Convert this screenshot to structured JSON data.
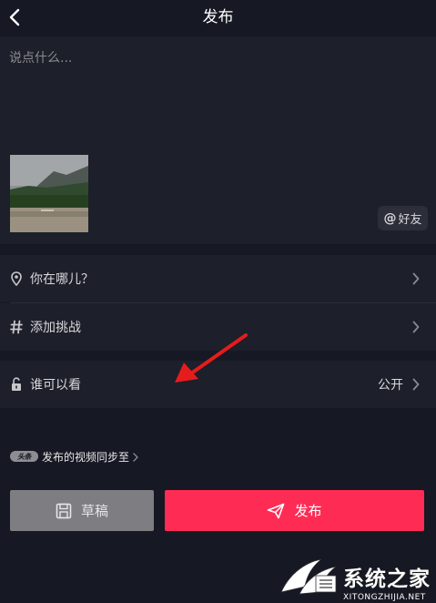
{
  "header": {
    "title": "发布"
  },
  "compose": {
    "placeholder": "说点什么...",
    "value": "",
    "mention_label": "好友"
  },
  "options": [
    {
      "name": "location",
      "label": "你在哪儿？",
      "value": ""
    },
    {
      "name": "challenge",
      "label": "添加挑战",
      "value": ""
    },
    {
      "name": "privacy",
      "label": "谁可以看",
      "value": "公开"
    }
  ],
  "sync": {
    "logo_text": "头条",
    "label": "发布的视频同步至"
  },
  "actions": {
    "draft_label": "草稿",
    "publish_label": "发布"
  },
  "watermark": {
    "title": "系统之家",
    "url": "XITONGZHIJIA.NET"
  },
  "colors": {
    "background": "#161823",
    "panel": "#1d1f2a",
    "accent": "#fe2c55",
    "draft": "#7d7d82",
    "annotation": "#e51c1c"
  },
  "icons": [
    "back-icon",
    "location-pin-icon",
    "hashtag-icon",
    "unlock-icon",
    "chevron-right-icon",
    "draft-save-icon",
    "send-icon",
    "red-arrow-annotation"
  ]
}
